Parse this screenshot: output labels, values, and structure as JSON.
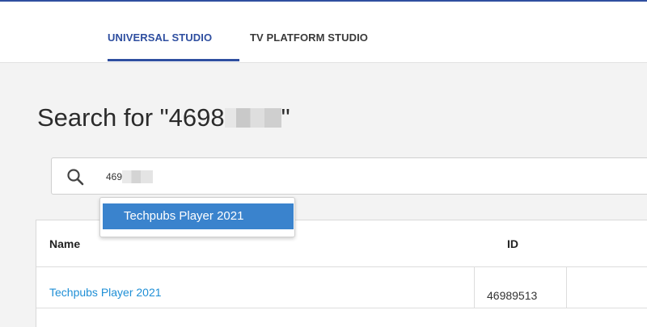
{
  "tabs": [
    {
      "label": "UNIVERSAL STUDIO",
      "active": true
    },
    {
      "label": "TV PLATFORM STUDIO",
      "active": false
    }
  ],
  "page": {
    "title_prefix": "Search for \"4698",
    "title_suffix": "\""
  },
  "search": {
    "value_visible": "469",
    "icon": "search-icon"
  },
  "suggestions": [
    {
      "label": "Techpubs Player 2021"
    }
  ],
  "table": {
    "columns": [
      "Name",
      "ID"
    ],
    "rows": [
      {
        "name": "Techpubs Player 2021",
        "id": "46989513"
      }
    ]
  },
  "colors": {
    "accent": "#2f4fa0",
    "link": "#1f8fd6",
    "highlight": "#3a83cd"
  }
}
